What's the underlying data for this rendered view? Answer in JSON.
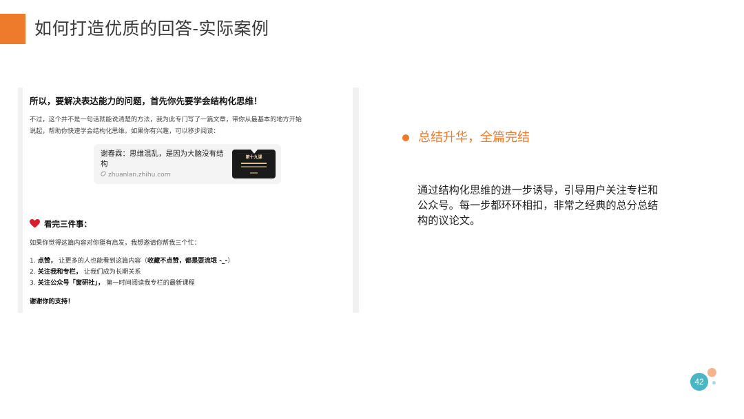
{
  "slide": {
    "title": "如何打造优质的回答-实际案例",
    "page_number": "42"
  },
  "article": {
    "heading": "所以，要解决表达能力的问题，首先你先要学会结构化思维！",
    "intro_lines": [
      "不过，这个并不是一句话就能说清楚的方法，我为此专门写了一篇文章，带你从最基本的地方开始",
      "说起，帮助你快速学会结构化思维。如果你有兴趣，可以移步阅读："
    ],
    "link_card": {
      "title": "谢春霖：思维混乱，是因为大脑没有结构",
      "url": "zhuanlan.zhihu.com",
      "thumbnail_title": "第十九课"
    },
    "section_heading": "看完三件事：",
    "ask": "如果你觉得这篇内容对你挺有启发，我想邀请你帮我三个忙：",
    "items": [
      {
        "num": "1.",
        "bold": "点赞，",
        "text": " 让更多的人也能看到这篇内容（",
        "bold2": "收藏不点赞，都是耍流氓 -_-",
        "text2": "）"
      },
      {
        "num": "2.",
        "bold": "关注我和专栏，",
        "text": " 让我们成为长期关系",
        "bold2": "",
        "text2": ""
      },
      {
        "num": "3.",
        "bold": "关注公众号「窗研社」，",
        "text": " 第一时间阅读我专栏的最新课程",
        "bold2": "",
        "text2": ""
      }
    ],
    "thanks": "谢谢你的支持！"
  },
  "bullet": {
    "text": "总结升华，全篇完结"
  },
  "summary_lines": [
    "通过结构化思维的进一步诱导，引导用户关注专栏和",
    "公众号。每一步都环环相扣，非常之经典的总分总结",
    "构的议论文。"
  ],
  "colors": {
    "accent": "#ee7a2b",
    "badge": "#4bb5c6"
  },
  "icons": {
    "heart": "heart-icon",
    "link": "link-icon"
  }
}
